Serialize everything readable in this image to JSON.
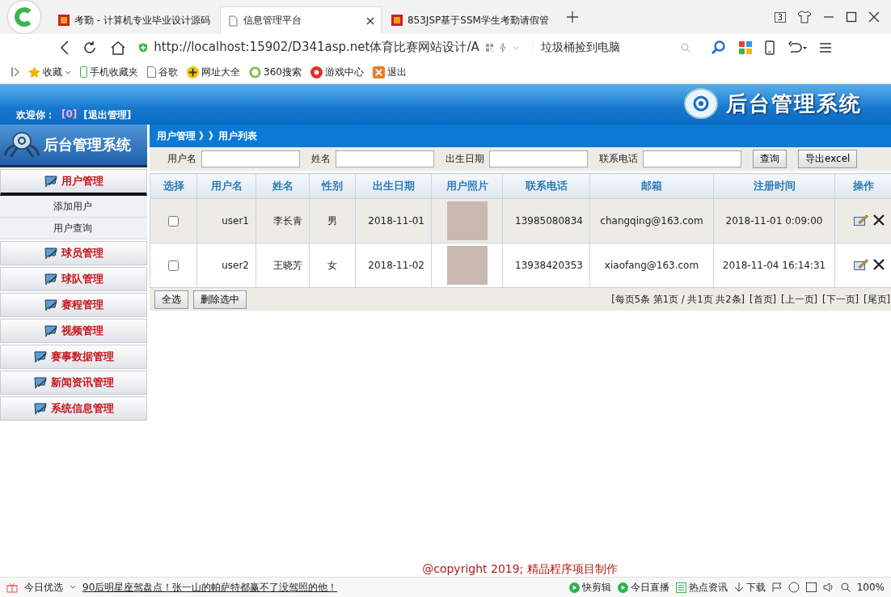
{
  "browser": {
    "tabs": [
      {
        "title": "考勤 - 计算机专业毕业设计源码",
        "selected": false
      },
      {
        "title": "信息管理平台",
        "selected": true
      },
      {
        "title": "853JSP基于SSM学生考勤请假管",
        "selected": false
      }
    ],
    "tab_count": "3",
    "url": "http://localhost:15902/D341asp.net体育比赛网站设计/A",
    "search_hint": "垃圾桶捡到电脑",
    "bookmarks": [
      {
        "label": "收藏",
        "kind": "star"
      },
      {
        "label": "手机收藏夹",
        "kind": "phone"
      },
      {
        "label": "谷歌",
        "kind": "page"
      },
      {
        "label": "网址大全",
        "kind": "plus"
      },
      {
        "label": "360搜索",
        "kind": "ring"
      },
      {
        "label": "游戏中心",
        "kind": "game"
      },
      {
        "label": "退出",
        "kind": "exit"
      }
    ]
  },
  "header": {
    "welcome": "欢迎你：",
    "user": "[0]",
    "logout": "[退出管理]",
    "logo_text": "后台管理系统"
  },
  "sidebar": {
    "logo_text": "后台管理系统",
    "items": [
      {
        "label": "用户管理",
        "expanded": true,
        "children": [
          {
            "label": "添加用户"
          },
          {
            "label": "用户查询"
          }
        ]
      },
      {
        "label": "球员管理",
        "expanded": false
      },
      {
        "label": "球队管理",
        "expanded": false
      },
      {
        "label": "赛程管理",
        "expanded": false
      },
      {
        "label": "视频管理",
        "expanded": false
      },
      {
        "label": "赛事数据管理",
        "expanded": false
      },
      {
        "label": "新闻资讯管理",
        "expanded": false
      },
      {
        "label": "系统信息管理",
        "expanded": false
      }
    ]
  },
  "breadcrumb": "用户管理 》》用户列表",
  "search_form": {
    "fields": [
      {
        "label": "用户名"
      },
      {
        "label": "姓名"
      },
      {
        "label": "出生日期"
      },
      {
        "label": "联系电话"
      }
    ],
    "buttons": [
      "查询",
      "导出excel"
    ]
  },
  "table": {
    "columns": [
      "选择",
      "用户名",
      "姓名",
      "性别",
      "出生日期",
      "用户照片",
      "联系电话",
      "邮箱",
      "注册时间",
      "操作"
    ],
    "rows": [
      {
        "checked": false,
        "username": "user1",
        "name": "李长青",
        "gender": "男",
        "birth": "2018-11-01",
        "phone": "13985080834",
        "email": "changqing@163.com",
        "registered": "2018-11-01 0:09:00"
      },
      {
        "checked": false,
        "username": "user2",
        "name": "王晓芳",
        "gender": "女",
        "birth": "2018-11-02",
        "phone": "13938420353",
        "email": "xiaofang@163.com",
        "registered": "2018-11-04 16:14:31"
      }
    ]
  },
  "bulk_buttons": [
    "全选",
    "删除选中"
  ],
  "pager": {
    "summary": "[每页5条 第1页 / 共1页 共2条]",
    "links": [
      "[首页]",
      "[上一页]",
      "[下一页]",
      "[尾页]"
    ]
  },
  "copyright": "@copyright 2019; 精品程序项目制作",
  "status_bar": {
    "left": "今日优选",
    "news": "90后明星座驾盘点！张一山的帕萨特都赢不了没驾照的他！",
    "items": [
      {
        "label": "快剪辑",
        "kind": "play"
      },
      {
        "label": "今日直播",
        "kind": "play"
      },
      {
        "label": "热点资讯",
        "kind": "news"
      },
      {
        "label": "下载",
        "kind": "download"
      }
    ],
    "zoom": "100%"
  }
}
